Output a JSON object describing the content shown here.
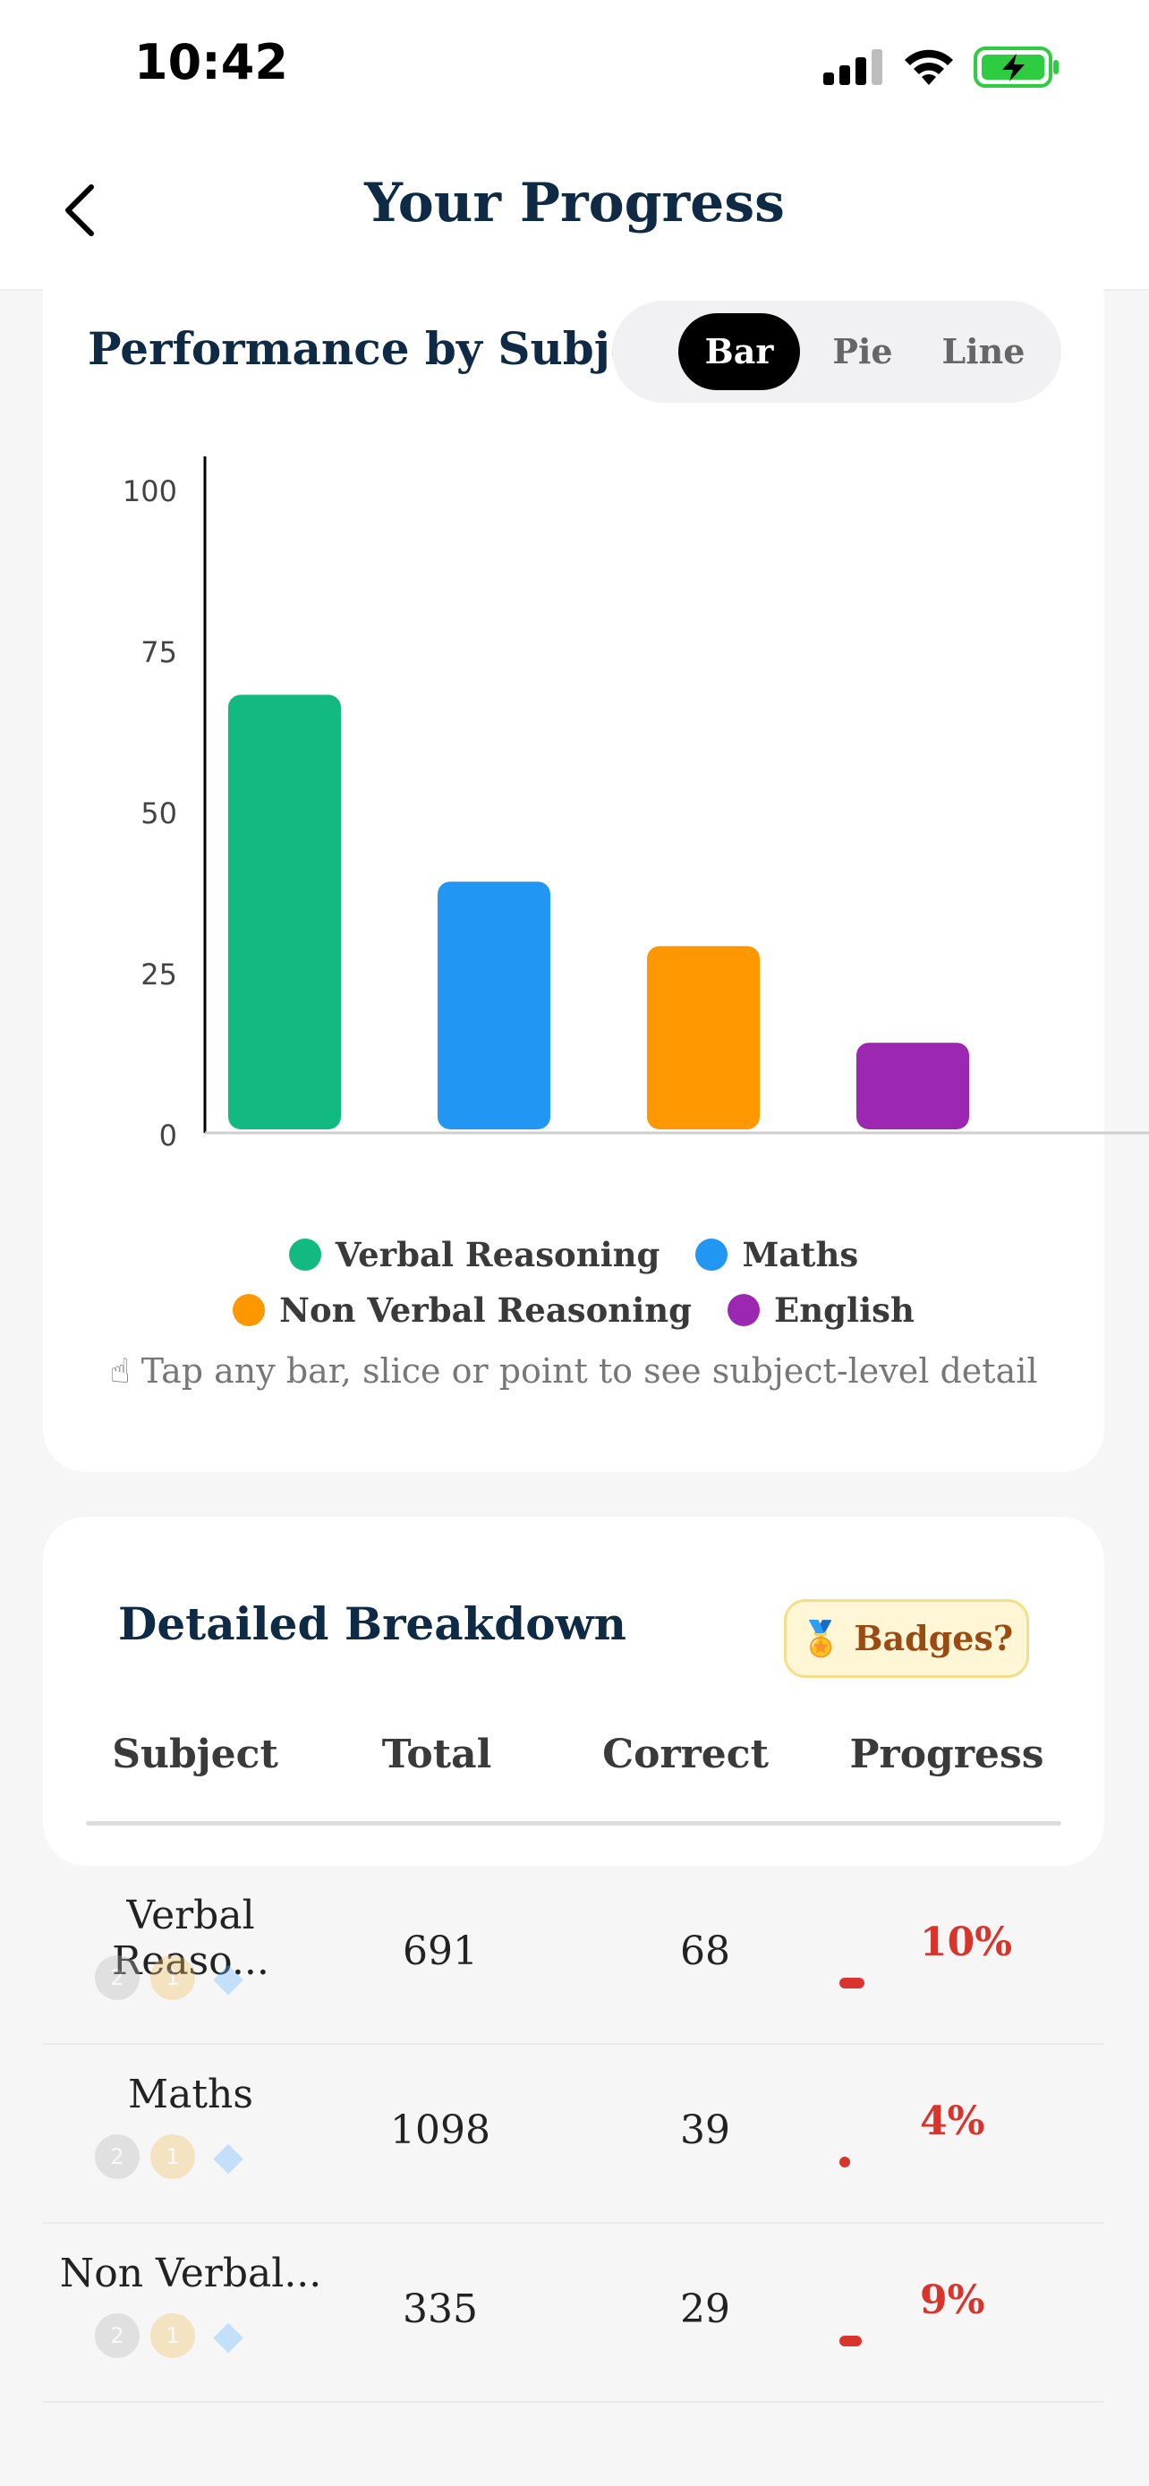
{
  "status": {
    "time": "10:42"
  },
  "header": {
    "title": "Your Progress"
  },
  "performance": {
    "title": "Performance by Subject",
    "chart_types": [
      "Bar",
      "Pie",
      "Line"
    ],
    "active_type": "Bar",
    "hint": "Tap any bar, slice or point to see subject-level detail",
    "hint_icon": "pointing-hand-icon"
  },
  "chart_data": {
    "type": "bar",
    "categories": [
      "Verbal Reasoning",
      "Maths",
      "Non Verbal Reasoning",
      "English"
    ],
    "values": [
      68,
      39,
      29,
      14
    ],
    "colors": [
      "#12b981",
      "#2196f3",
      "#ff9800",
      "#9c27b0"
    ],
    "yticks": [
      0,
      25,
      50,
      75,
      100
    ],
    "ylim": [
      0,
      100
    ],
    "legend_position": "bottom"
  },
  "breakdown": {
    "title": "Detailed Breakdown",
    "badges_label": "Badges?",
    "columns": [
      "Subject",
      "Total",
      "Correct",
      "Progress"
    ],
    "rows": [
      {
        "subject": "Verbal Reaso...",
        "total": "691",
        "correct": "68",
        "progress": "10%",
        "progress_value": 0.1
      },
      {
        "subject": "Maths",
        "total": "1098",
        "correct": "39",
        "progress": "4%",
        "progress_value": 0.04
      },
      {
        "subject": "Non Verbal...",
        "total": "335",
        "correct": "29",
        "progress": "9%",
        "progress_value": 0.09
      }
    ],
    "progress_color": "#d9342b"
  }
}
